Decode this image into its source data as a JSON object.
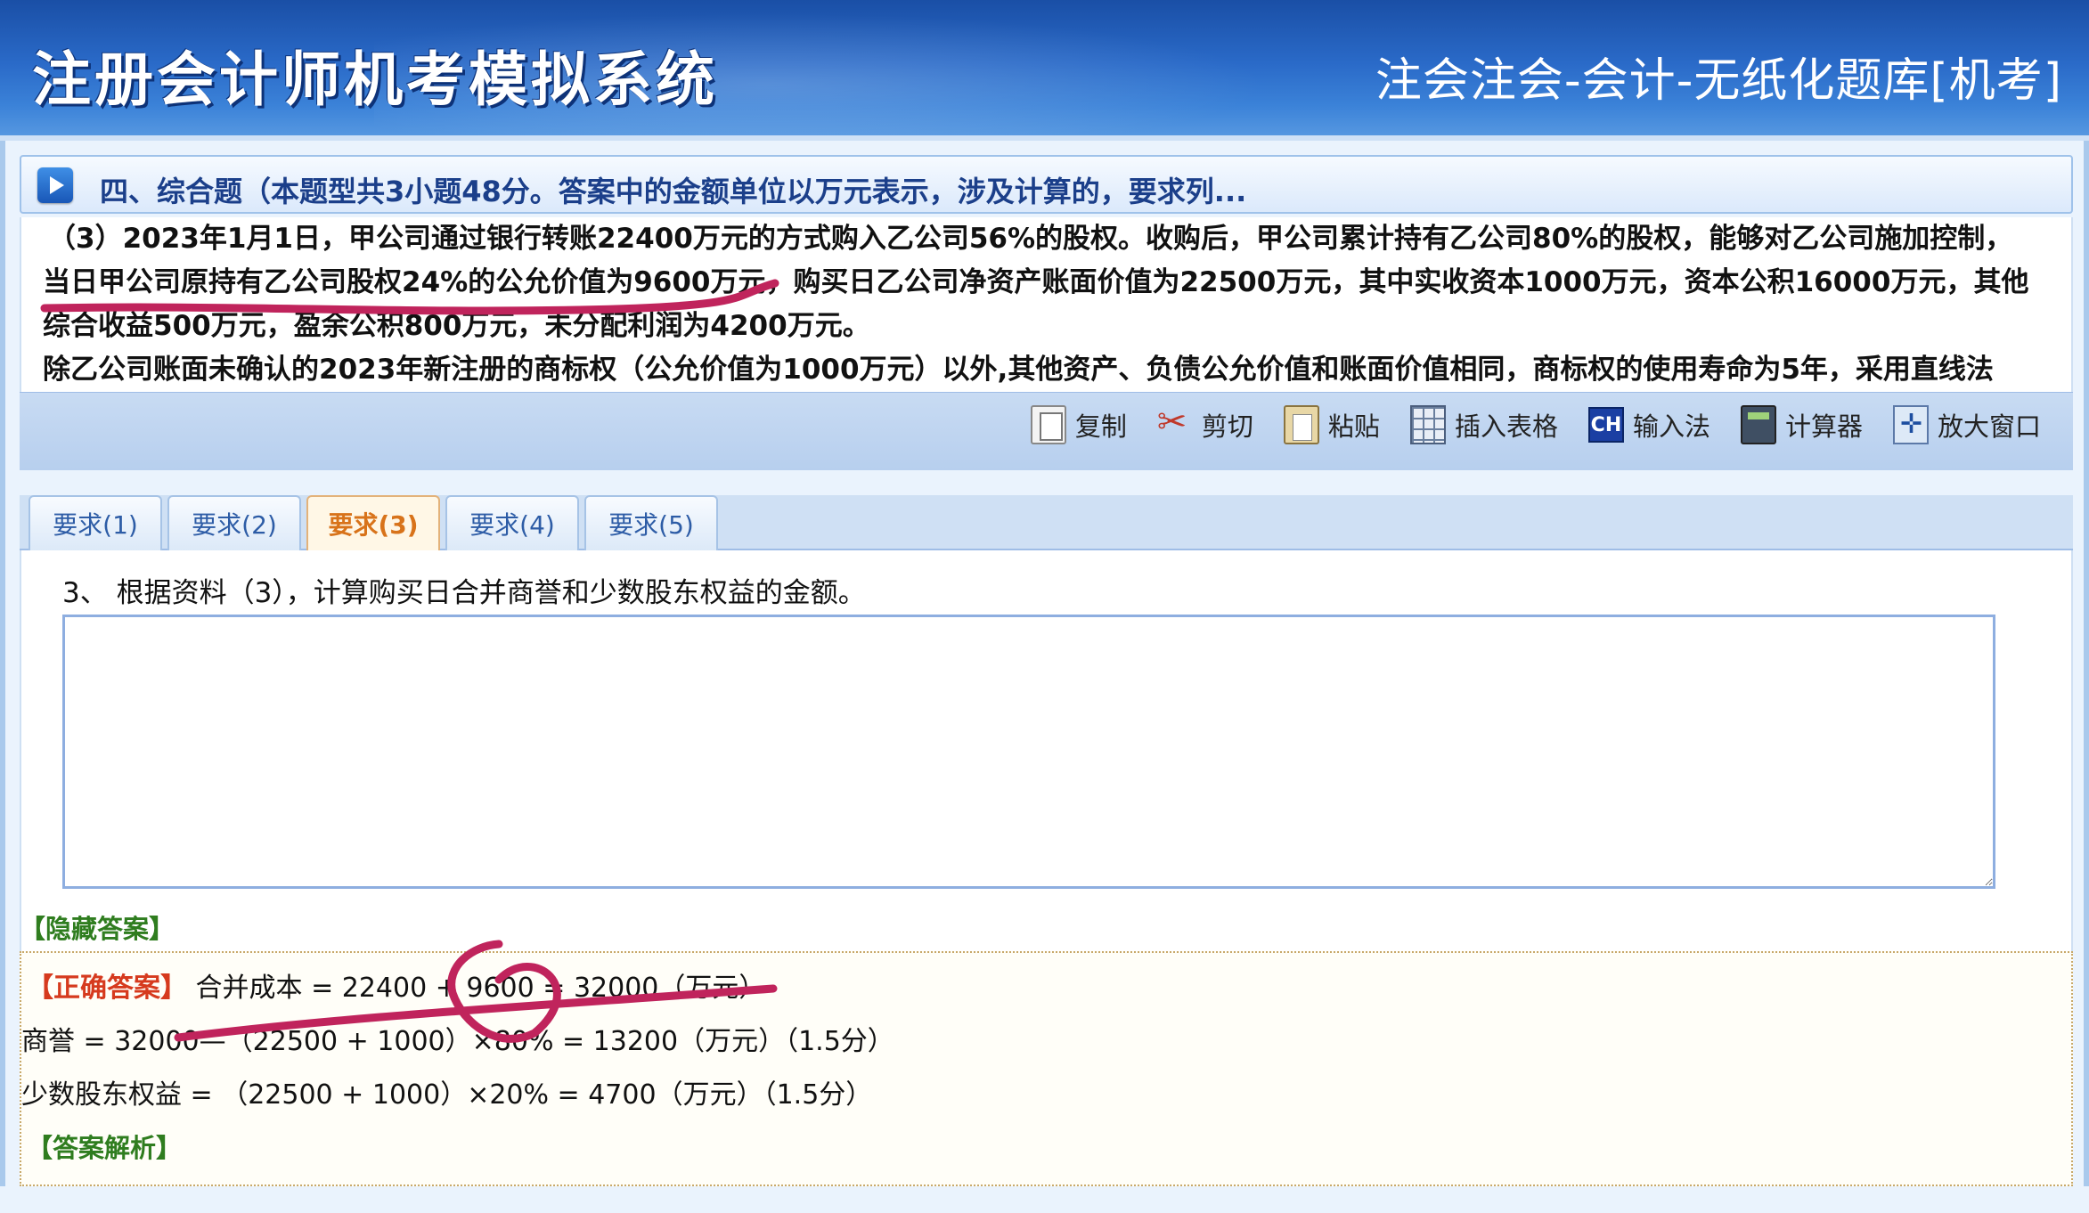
{
  "header": {
    "title": "注册会计师机考模拟系统",
    "subtitle": "注会注会-会计-无纸化题库[机考]"
  },
  "section": {
    "title": "四、综合题（本题型共3小题48分。答案中的金额单位以万元表示，涉及计算的，要求列..."
  },
  "material": {
    "lines": [
      "（3）2023年1月1日，甲公司通过银行转账22400万元的方式购入乙公司56%的股权。收购后，甲公司累计持有乙公司80%的股权，能够对乙公司施加控制，",
      "当日甲公司原持有乙公司股权24%的公允价值为9600万元，购买日乙公司净资产账面价值为22500万元，其中实收资本1000万元，资本公积16000万元，其他",
      "综合收益500万元，盈余公积800万元，未分配利润为4200万元。",
      "除乙公司账面未确认的2023年新注册的商标权（公允价值为1000万元）以外,其他资产、负债公允价值和账面价值相同，商标权的使用寿命为5年，采用直线法"
    ]
  },
  "toolbar": {
    "items": [
      {
        "label": "复制",
        "icon": "copy-icon"
      },
      {
        "label": "剪切",
        "icon": "scissors-icon"
      },
      {
        "label": "粘贴",
        "icon": "paste-icon"
      },
      {
        "label": "插入表格",
        "icon": "table-icon"
      },
      {
        "label": "输入法",
        "icon": "ime-icon",
        "icon_text": "CH"
      },
      {
        "label": "计算器",
        "icon": "calculator-icon"
      },
      {
        "label": "放大窗口",
        "icon": "maximize-icon"
      }
    ]
  },
  "tabs": [
    {
      "label": "要求(1)",
      "active": false
    },
    {
      "label": "要求(2)",
      "active": false
    },
    {
      "label": "要求(3)",
      "active": true
    },
    {
      "label": "要求(4)",
      "active": false
    },
    {
      "label": "要求(5)",
      "active": false
    }
  ],
  "question": {
    "text": "3、 根据资料（3），计算购买日合并商誉和少数股东权益的金额。"
  },
  "answer": {
    "hide_label": "【隐藏答案】",
    "correct_label": "【正确答案】",
    "line1": " 合并成本 = 22400 + 9600 = 32000（万元）",
    "line2": "商誉 = 32000—（22500 + 1000）×80% = 13200（万元）（1.5分）",
    "line3": "少数股东权益 = （22500 + 1000）×20% = 4700（万元）（1.5分）",
    "analysis_label": "【答案解析】"
  },
  "colors": {
    "banner": "#2a6ac8",
    "active_tab_text": "#d8731a",
    "correct_label": "#d63a1e",
    "green_label": "#2f7d1f",
    "annotation": "#c0245c"
  }
}
